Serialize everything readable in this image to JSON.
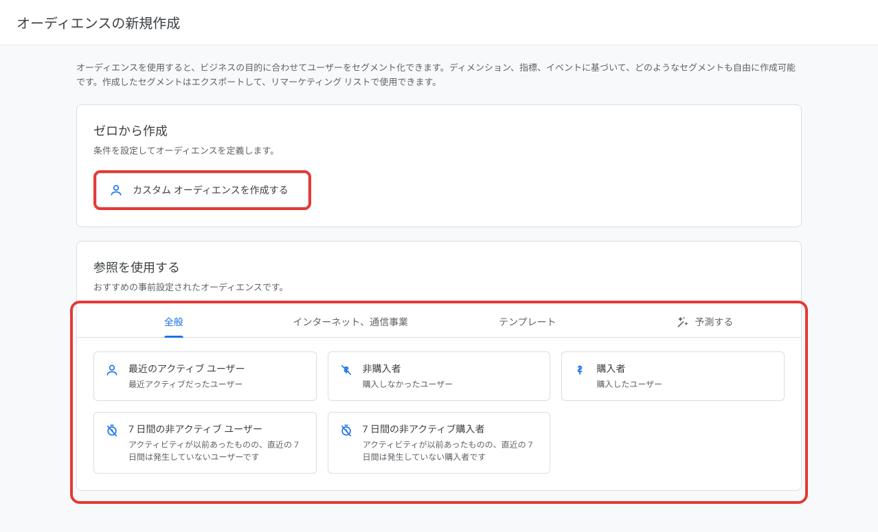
{
  "header": {
    "title": "オーディエンスの新規作成"
  },
  "intro": "オーディエンスを使用すると、ビジネスの目的に合わせてユーザーをセグメント化できます。ディメンション、指標、イベントに基づいて、どのようなセグメントも自由に作成可能です。作成したセグメントはエクスポートして、リマーケティング リストで使用できます。",
  "scratch": {
    "title": "ゼロから作成",
    "subtitle": "条件を設定してオーディエンスを定義します。",
    "create_custom_label": "カスタム オーディエンスを作成する"
  },
  "reference": {
    "title": "参照を使用する",
    "subtitle": "おすすめの事前設定されたオーディエンスです。",
    "tabs": {
      "general": "全般",
      "internet_telecom": "インターネット、通信事業",
      "templates": "テンプレート",
      "predict": "予測する"
    },
    "tiles": {
      "recent_active": {
        "title": "最近のアクティブ ユーザー",
        "desc": "最近アクティブだったユーザー"
      },
      "non_purchasers": {
        "title": "非購入者",
        "desc": "購入しなかったユーザー"
      },
      "purchasers": {
        "title": "購入者",
        "desc": "購入したユーザー"
      },
      "inactive_7d_users": {
        "title": "7 日間の非アクティブ ユーザー",
        "desc": "アクティビティが以前あったものの、直近の 7 日間は発生していないユーザーです"
      },
      "inactive_7d_purchasers": {
        "title": "7 日間の非アクティブ購入者",
        "desc": "アクティビティが以前あったものの、直近の 7 日間は発生していない購入者です"
      }
    }
  }
}
